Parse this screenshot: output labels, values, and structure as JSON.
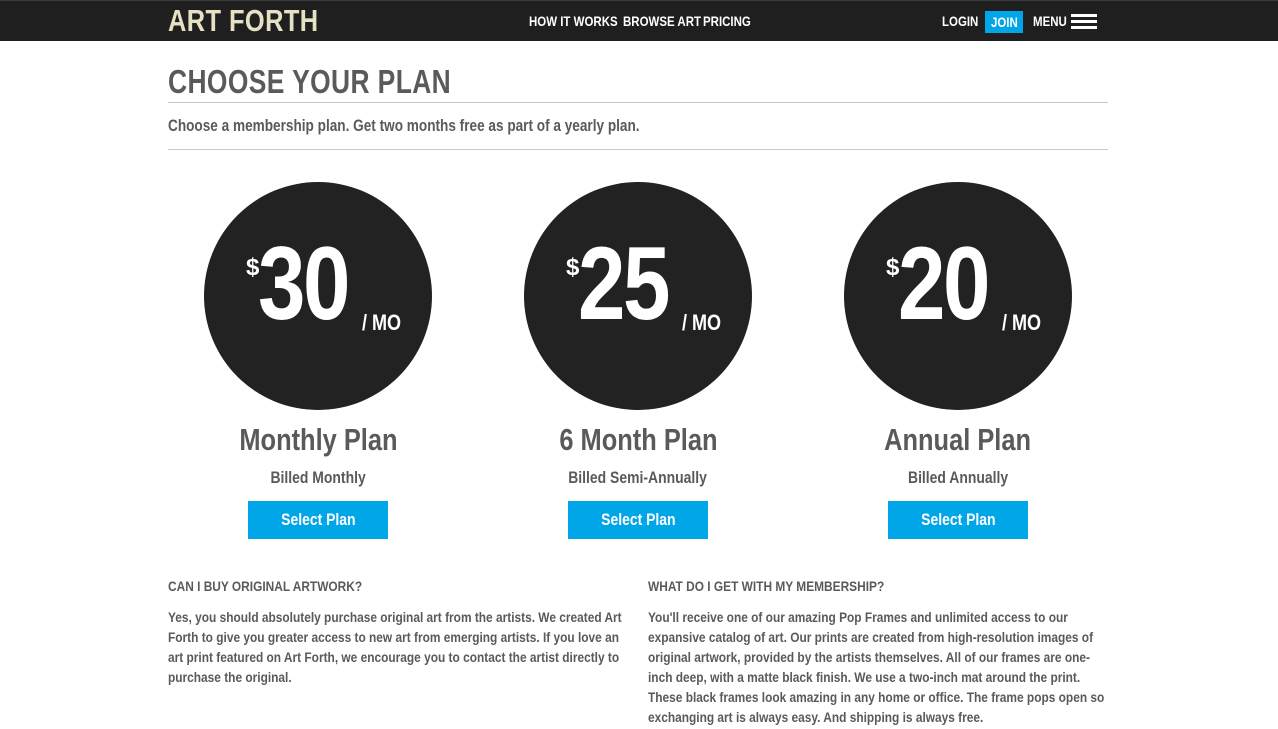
{
  "nav": {
    "logo": "ART FORTH",
    "links": [
      "HOW IT WORKS",
      "BROWSE ART",
      "PRICING"
    ],
    "login": "LOGIN",
    "join": "JOIN",
    "menu": "MENU",
    "menu_icon": "hamburger-icon",
    "colors": {
      "bar": "#1f1f1f",
      "logo": "#e6e1c3",
      "accent": "#00a6e8"
    }
  },
  "header": {
    "title": "CHOOSE YOUR PLAN",
    "subtitle": "Choose a membership plan. Get two months free as part of a yearly plan."
  },
  "plans": [
    {
      "currency": "$",
      "amount": "30",
      "period": "/ MO",
      "name": "Monthly Plan",
      "billing": "Billed Monthly",
      "button": "Select Plan"
    },
    {
      "currency": "$",
      "amount": "25",
      "period": "/ MO",
      "name": "6 Month Plan",
      "billing": "Billed Semi-Annually",
      "button": "Select Plan"
    },
    {
      "currency": "$",
      "amount": "20",
      "period": "/ MO",
      "name": "Annual Plan",
      "billing": "Billed Annually",
      "button": "Select Plan"
    }
  ],
  "faq": [
    {
      "question": "CAN I BUY ORIGINAL ARTWORK?",
      "answer": "Yes, you should absolutely purchase original art from the artists. We created Art Forth to give you greater access to new art from emerging artists. If you love an art print featured on Art Forth, we encourage you to contact the artist directly to purchase the original."
    },
    {
      "question": "WHAT DO I GET WITH MY MEMBERSHIP?",
      "answer": "You'll receive one of our amazing Pop Frames and unlimited access to our expansive catalog of art. Our prints are created from high-resolution images of original artwork, provided by the artists themselves. All of our frames are one-inch deep, with a matte black finish. We use a two-inch mat around the print. These black frames look amazing in any home or office. The frame pops open so exchanging art is always easy. And shipping is always free."
    }
  ]
}
